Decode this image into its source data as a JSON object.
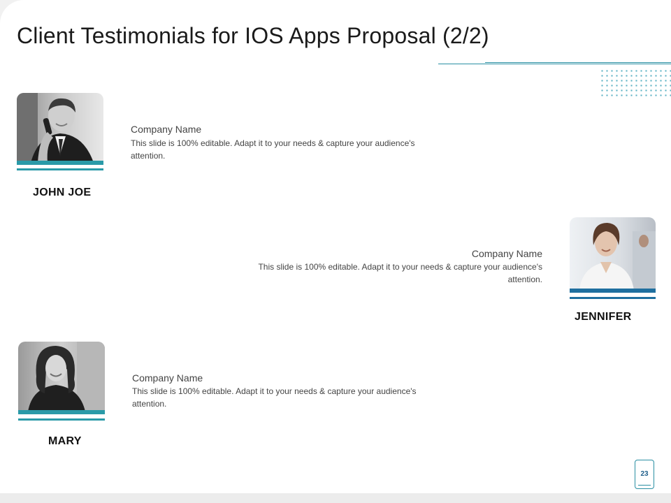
{
  "slide": {
    "title": "Client  Testimonials for  IOS  Apps Proposal  (2/2)",
    "page_number": "23"
  },
  "testimonials": [
    {
      "name": "JOHN JOE",
      "company": "Company Name",
      "text": "This slide is 100% editable. Adapt it to your needs & capture your audience's attention.",
      "photo_icon": "man-on-phone-photo",
      "accent": "#2a9aa8"
    },
    {
      "name": "JENNIFER",
      "company": "Company Name",
      "text": "This slide is 100% editable. Adapt it to your needs & capture your audience's attention.",
      "photo_icon": "woman-office-photo",
      "accent": "#1f6f9f"
    },
    {
      "name": "MARY",
      "company": "Company Name",
      "text": "This slide is 100% editable. Adapt it to your needs & capture your audience's attention.",
      "photo_icon": "young-woman-photo",
      "accent": "#2a9aa8"
    }
  ]
}
